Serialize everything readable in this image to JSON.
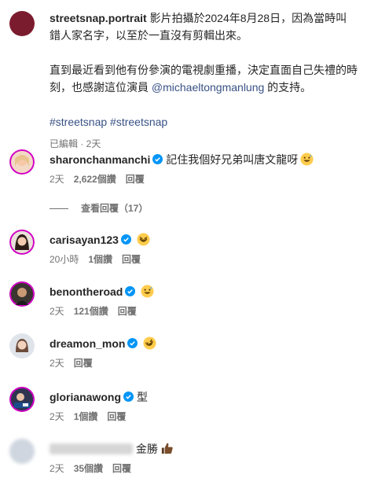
{
  "post": {
    "username": "streetsnap.portrait",
    "text1": "影片拍攝於2024年8月28日，因為當時叫錯人家名字，以至於一直沒有剪輯出來。",
    "text2a": "直到最近看到他有份參演的電視劇重播，決定直面自己失禮的時刻，也感謝這位演員 ",
    "mention": "@michaeltongmanlung",
    "text2b": " 的支持。",
    "hashtags": "#streetsnap #streetsnap",
    "meta": "已編輯 · 2天"
  },
  "comments": [
    {
      "username": "sharonchanmanchi",
      "text": "記住我個好兄弟叫唐文龍呀",
      "emoji": "grin-sweat-icon",
      "time": "2天",
      "likes": "2,622個讚",
      "reply": "回覆"
    },
    {
      "username": "carisayan123",
      "text": "",
      "emoji": "laugh-icon",
      "time": "20小時",
      "likes": "1個讚",
      "reply": "回覆"
    },
    {
      "username": "benontheroad",
      "text": "",
      "emoji": "grin-sweat-icon",
      "time": "2天",
      "likes": "121個讚",
      "reply": "回覆"
    },
    {
      "username": "dreamon_mon",
      "text": "",
      "emoji": "rofl-icon",
      "time": "2天",
      "likes": "",
      "reply": "回覆"
    },
    {
      "username": "glorianawong",
      "text": "型",
      "emoji": "",
      "time": "2天",
      "likes": "1個讚",
      "reply": "回覆"
    },
    {
      "username": "",
      "text": "金勝",
      "emoji": "thumbs-up-icon",
      "time": "2天",
      "likes": "35個讚",
      "reply": "回覆"
    }
  ],
  "view_replies": "查看回覆（17）",
  "colors": {
    "link": "#385185",
    "verified": "#0095f6",
    "muted": "#737373"
  }
}
